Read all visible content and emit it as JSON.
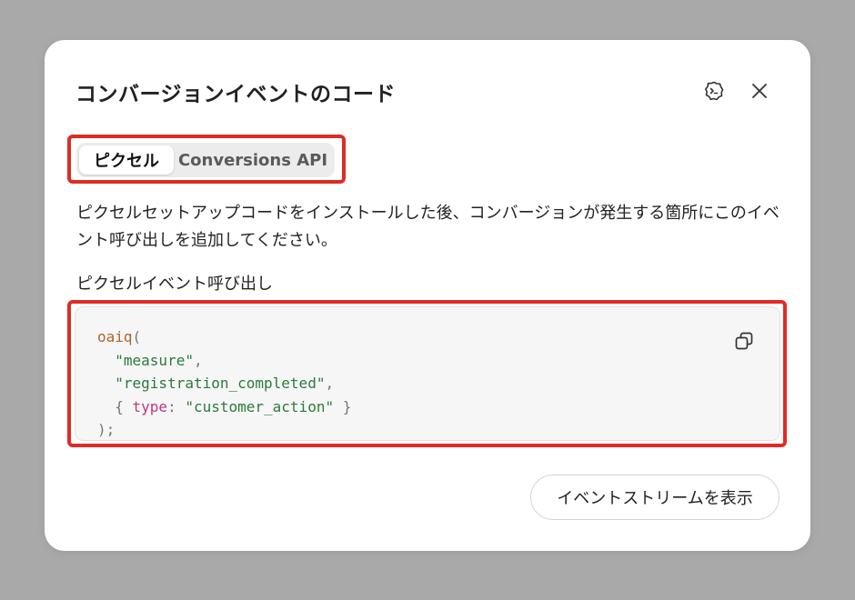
{
  "modal": {
    "title": "コンバージョンイベントのコード",
    "ai_icon": "ai-assistant-icon",
    "close_icon": "close-icon"
  },
  "tabs": [
    {
      "label": "ピクセル",
      "active": true
    },
    {
      "label": "Conversions API",
      "active": false
    }
  ],
  "description": "ピクセルセットアップコードをインストールした後、コンバージョンが発生する箇所にこのイベント呼び出しを追加してください。",
  "code_section": {
    "label": "ピクセルイベント呼び出し",
    "copy_icon": "copy-icon",
    "lines": {
      "fn": "oaiq",
      "open_paren": "(",
      "arg1": "\"measure\"",
      "arg2": "\"registration_completed\"",
      "obj_open": "{ ",
      "key": "type",
      "colon": ": ",
      "value": "\"customer_action\"",
      "obj_close": " }",
      "close": ");"
    }
  },
  "footer": {
    "stream_button_label": "イベントストリームを表示"
  },
  "colors": {
    "highlight": "#e02b25",
    "code_fn": "#b0632a",
    "code_string": "#2d7a3a",
    "code_key": "#c0387a"
  }
}
